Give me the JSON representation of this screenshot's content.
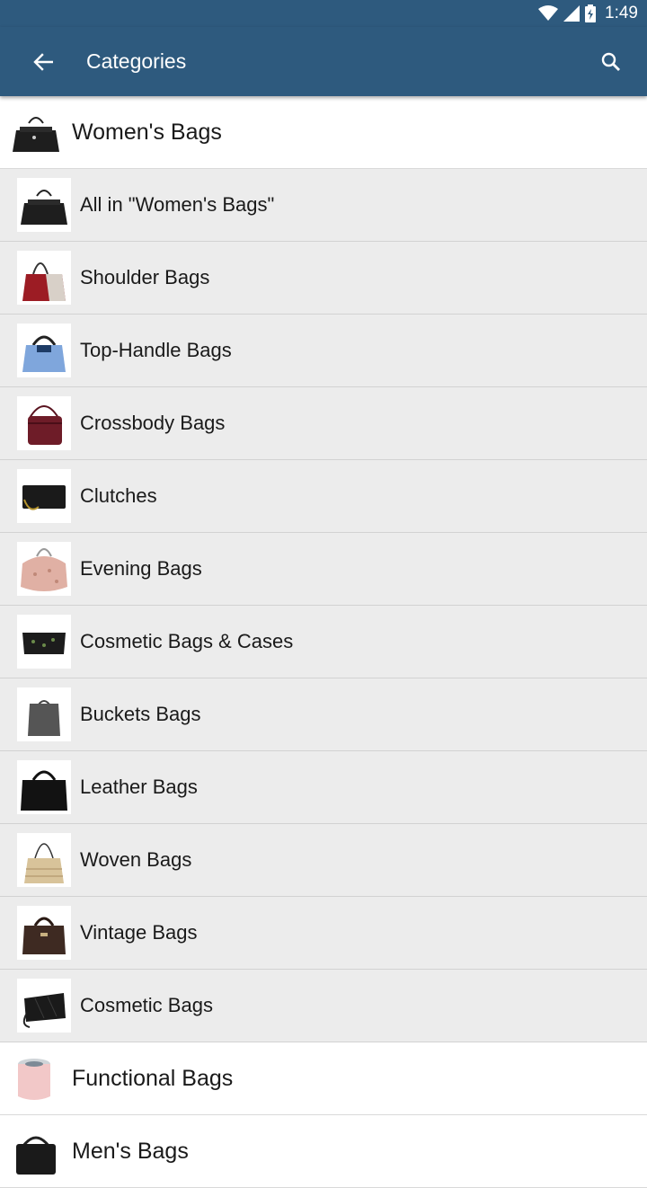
{
  "status_bar": {
    "time": "1:49",
    "icons": [
      "wifi-icon",
      "signal-icon",
      "battery-icon"
    ]
  },
  "app_bar": {
    "title": "Categories",
    "back_icon": "arrow-left-icon",
    "search_icon": "search-icon"
  },
  "colors": {
    "primary": "#2e5a7e",
    "subcategory_bg": "#ececec",
    "category_bg": "#ffffff"
  },
  "categories": [
    {
      "label": "Women's Bags",
      "subcategories": [
        {
          "label": "All in \"Women's Bags\""
        },
        {
          "label": "Shoulder Bags"
        },
        {
          "label": "Top-Handle Bags"
        },
        {
          "label": "Crossbody Bags"
        },
        {
          "label": "Clutches"
        },
        {
          "label": "Evening Bags"
        },
        {
          "label": "Cosmetic Bags & Cases"
        },
        {
          "label": "Buckets Bags"
        },
        {
          "label": "Leather Bags"
        },
        {
          "label": "Woven Bags"
        },
        {
          "label": "Vintage Bags"
        },
        {
          "label": "Cosmetic Bags"
        }
      ]
    },
    {
      "label": "Functional Bags"
    },
    {
      "label": "Men's Bags"
    }
  ]
}
